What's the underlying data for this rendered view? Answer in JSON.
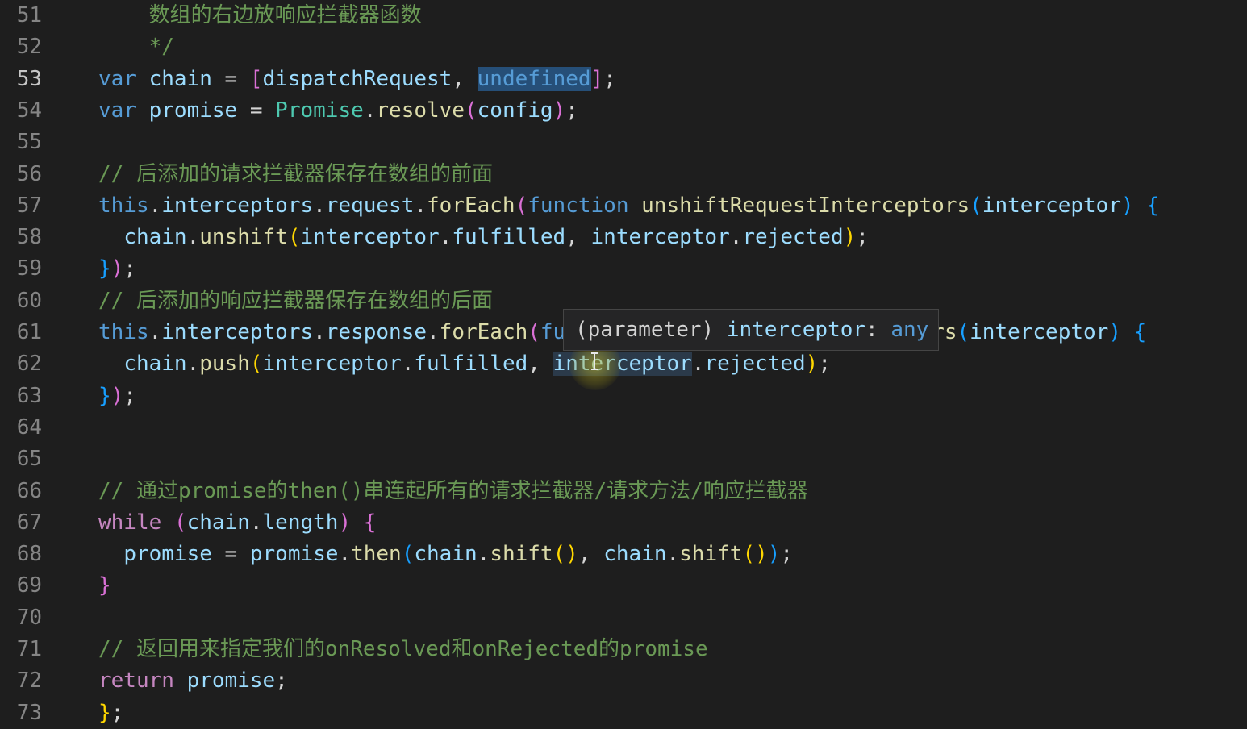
{
  "editor": {
    "language": "JavaScript",
    "active_line": "53",
    "hover_tooltip": {
      "kind": "(parameter)",
      "name": "interceptor",
      "type": "any"
    },
    "lines": [
      {
        "number": "51",
        "tokens": [
          {
            "t": "    数组的右边放响应拦截器函数",
            "c": "cm"
          }
        ]
      },
      {
        "number": "52",
        "tokens": [
          {
            "t": "    */",
            "c": "cm"
          }
        ]
      },
      {
        "number": "53",
        "tokens": [
          {
            "t": "var",
            "c": "kw"
          },
          {
            "t": " ",
            "c": "pn"
          },
          {
            "t": "chain",
            "c": "var"
          },
          {
            "t": " = ",
            "c": "pn"
          },
          {
            "t": "[",
            "c": "br2"
          },
          {
            "t": "dispatchRequest",
            "c": "var"
          },
          {
            "t": ", ",
            "c": "pn"
          },
          {
            "t": "undefined",
            "c": "kw hl"
          },
          {
            "t": "]",
            "c": "br2"
          },
          {
            "t": ";",
            "c": "pn"
          }
        ]
      },
      {
        "number": "54",
        "tokens": [
          {
            "t": "var",
            "c": "kw"
          },
          {
            "t": " ",
            "c": "pn"
          },
          {
            "t": "promise",
            "c": "var"
          },
          {
            "t": " = ",
            "c": "pn"
          },
          {
            "t": "Promise",
            "c": "cls"
          },
          {
            "t": ".",
            "c": "pn"
          },
          {
            "t": "resolve",
            "c": "fn"
          },
          {
            "t": "(",
            "c": "br2"
          },
          {
            "t": "config",
            "c": "var"
          },
          {
            "t": ")",
            "c": "br2"
          },
          {
            "t": ";",
            "c": "pn"
          }
        ]
      },
      {
        "number": "55",
        "tokens": []
      },
      {
        "number": "56",
        "tokens": [
          {
            "t": "// 后添加的请求拦截器保存在数组的前面",
            "c": "cm"
          }
        ]
      },
      {
        "number": "57",
        "tokens": [
          {
            "t": "this",
            "c": "kw"
          },
          {
            "t": ".",
            "c": "pn"
          },
          {
            "t": "interceptors",
            "c": "var"
          },
          {
            "t": ".",
            "c": "pn"
          },
          {
            "t": "request",
            "c": "var"
          },
          {
            "t": ".",
            "c": "pn"
          },
          {
            "t": "forEach",
            "c": "fn"
          },
          {
            "t": "(",
            "c": "br2"
          },
          {
            "t": "function",
            "c": "kw"
          },
          {
            "t": " ",
            "c": "pn"
          },
          {
            "t": "unshiftRequestInterceptors",
            "c": "fn"
          },
          {
            "t": "(",
            "c": "br3"
          },
          {
            "t": "interceptor",
            "c": "var"
          },
          {
            "t": ")",
            "c": "br3"
          },
          {
            "t": " ",
            "c": "pn"
          },
          {
            "t": "{",
            "c": "br3"
          }
        ]
      },
      {
        "number": "58",
        "tokens": [
          {
            "t": "  ",
            "c": "pn"
          },
          {
            "t": "chain",
            "c": "var"
          },
          {
            "t": ".",
            "c": "pn"
          },
          {
            "t": "unshift",
            "c": "fn"
          },
          {
            "t": "(",
            "c": "br1"
          },
          {
            "t": "interceptor",
            "c": "var"
          },
          {
            "t": ".",
            "c": "pn"
          },
          {
            "t": "fulfilled",
            "c": "var"
          },
          {
            "t": ", ",
            "c": "pn"
          },
          {
            "t": "interceptor",
            "c": "var"
          },
          {
            "t": ".",
            "c": "pn"
          },
          {
            "t": "rejected",
            "c": "var"
          },
          {
            "t": ")",
            "c": "br1"
          },
          {
            "t": ";",
            "c": "pn"
          }
        ]
      },
      {
        "number": "59",
        "tokens": [
          {
            "t": "}",
            "c": "br3"
          },
          {
            "t": ")",
            "c": "br2"
          },
          {
            "t": ";",
            "c": "pn"
          }
        ]
      },
      {
        "number": "60",
        "tokens": [
          {
            "t": "// 后添加的响应拦截器保存在数组的后面",
            "c": "cm"
          }
        ]
      },
      {
        "number": "61",
        "tokens": [
          {
            "t": "this",
            "c": "kw"
          },
          {
            "t": ".",
            "c": "pn"
          },
          {
            "t": "interceptors",
            "c": "var"
          },
          {
            "t": ".",
            "c": "pn"
          },
          {
            "t": "response",
            "c": "var"
          },
          {
            "t": ".",
            "c": "pn"
          },
          {
            "t": "forEach",
            "c": "fn"
          },
          {
            "t": "(",
            "c": "br2"
          },
          {
            "t": "function",
            "c": "kw"
          },
          {
            "t": " ",
            "c": "pn"
          },
          {
            "t": "pushResponseInterceptors",
            "c": "fn"
          },
          {
            "t": "(",
            "c": "br3"
          },
          {
            "t": "interceptor",
            "c": "var"
          },
          {
            "t": ")",
            "c": "br3"
          },
          {
            "t": " ",
            "c": "pn"
          },
          {
            "t": "{",
            "c": "br3"
          }
        ]
      },
      {
        "number": "62",
        "tokens": [
          {
            "t": "  ",
            "c": "pn"
          },
          {
            "t": "chain",
            "c": "var"
          },
          {
            "t": ".",
            "c": "pn"
          },
          {
            "t": "push",
            "c": "fn"
          },
          {
            "t": "(",
            "c": "br1"
          },
          {
            "t": "interceptor",
            "c": "var"
          },
          {
            "t": ".",
            "c": "pn"
          },
          {
            "t": "fulfilled",
            "c": "var"
          },
          {
            "t": ", ",
            "c": "pn"
          },
          {
            "t": "interceptor",
            "c": "var hl2"
          },
          {
            "t": ".",
            "c": "pn"
          },
          {
            "t": "rejected",
            "c": "var"
          },
          {
            "t": ")",
            "c": "br1"
          },
          {
            "t": ";",
            "c": "pn"
          }
        ]
      },
      {
        "number": "63",
        "tokens": [
          {
            "t": "}",
            "c": "br3"
          },
          {
            "t": ")",
            "c": "br2"
          },
          {
            "t": ";",
            "c": "pn"
          }
        ]
      },
      {
        "number": "64",
        "tokens": []
      },
      {
        "number": "65",
        "tokens": []
      },
      {
        "number": "66",
        "tokens": [
          {
            "t": "// 通过promise的then()串连起所有的请求拦截器/请求方法/响应拦截器",
            "c": "cm"
          }
        ]
      },
      {
        "number": "67",
        "tokens": [
          {
            "t": "while",
            "c": "ctl"
          },
          {
            "t": " ",
            "c": "pn"
          },
          {
            "t": "(",
            "c": "br2"
          },
          {
            "t": "chain",
            "c": "var"
          },
          {
            "t": ".",
            "c": "pn"
          },
          {
            "t": "length",
            "c": "var"
          },
          {
            "t": ")",
            "c": "br2"
          },
          {
            "t": " ",
            "c": "pn"
          },
          {
            "t": "{",
            "c": "br2"
          }
        ]
      },
      {
        "number": "68",
        "tokens": [
          {
            "t": "  ",
            "c": "pn"
          },
          {
            "t": "promise",
            "c": "var"
          },
          {
            "t": " = ",
            "c": "pn"
          },
          {
            "t": "promise",
            "c": "var"
          },
          {
            "t": ".",
            "c": "pn"
          },
          {
            "t": "then",
            "c": "fn"
          },
          {
            "t": "(",
            "c": "br3"
          },
          {
            "t": "chain",
            "c": "var"
          },
          {
            "t": ".",
            "c": "pn"
          },
          {
            "t": "shift",
            "c": "fn"
          },
          {
            "t": "()",
            "c": "br1"
          },
          {
            "t": ", ",
            "c": "pn"
          },
          {
            "t": "chain",
            "c": "var"
          },
          {
            "t": ".",
            "c": "pn"
          },
          {
            "t": "shift",
            "c": "fn"
          },
          {
            "t": "()",
            "c": "br1"
          },
          {
            "t": ")",
            "c": "br3"
          },
          {
            "t": ";",
            "c": "pn"
          }
        ]
      },
      {
        "number": "69",
        "tokens": [
          {
            "t": "}",
            "c": "br2"
          }
        ]
      },
      {
        "number": "70",
        "tokens": []
      },
      {
        "number": "71",
        "tokens": [
          {
            "t": "// 返回用来指定我们的onResolved和onRejected的promise",
            "c": "cm"
          }
        ]
      },
      {
        "number": "72",
        "tokens": [
          {
            "t": "return",
            "c": "ctl"
          },
          {
            "t": " ",
            "c": "pn"
          },
          {
            "t": "promise",
            "c": "var"
          },
          {
            "t": ";",
            "c": "pn"
          }
        ]
      },
      {
        "number": "73",
        "tokens": [
          {
            "t": "}",
            "c": "br1"
          },
          {
            "t": ";",
            "c": "pn"
          }
        ]
      }
    ]
  }
}
